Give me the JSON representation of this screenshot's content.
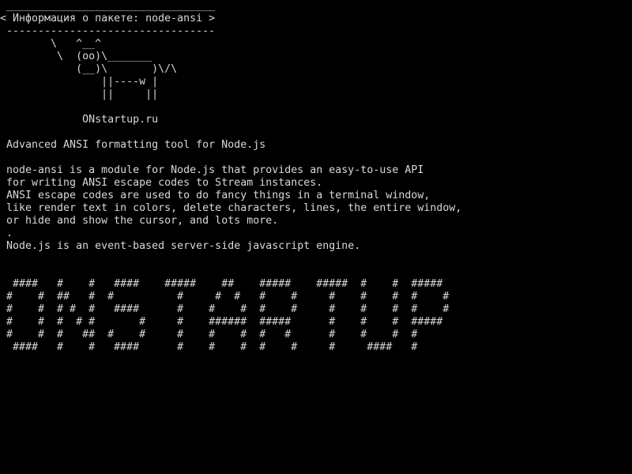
{
  "terminal": {
    "banner": {
      "top_border": " _________________________________",
      "title_line": "< Информация о пакете: node-ansi >",
      "bottom_border": " ---------------------------------"
    },
    "cow": [
      "        \\   ^__^",
      "         \\  (oo)\\_______",
      "            (__)\\       )\\/\\",
      "                ||----w |",
      "                ||     ||"
    ],
    "site": "             ONstartup.ru",
    "summary": " Advanced ANSI formatting tool for Node.js",
    "description": [
      " node-ansi is a module for Node.js that provides an easy-to-use API",
      " for writing ANSI escape codes to Stream instances.",
      " ANSI escape codes are used to do fancy things in a terminal window,",
      " like render text in colors, delete characters, lines, the entire window,",
      " or hide and show the cursor, and lots more.",
      " .",
      " Node.js is an event-based server-side javascript engine."
    ],
    "big_text": [
      "  ####   #    #   ####    #####    ##    #####    #####  #    #  #####",
      " #    #  ##   #  #          #     #  #   #    #     #    #    #  #    #",
      " #    #  # #  #   ####      #    #    #  #    #     #    #    #  #    #",
      " #    #  #  # #       #     #    ######  #####      #    #    #  #####",
      " #    #  #   ##  #    #     #    #    #  #   #      #    #    #  #",
      "  ####   #    #   ####      #    #    #  #    #     #     ####   #"
    ],
    "colors": {
      "background": "#000000",
      "text": "#d8d8d8"
    }
  }
}
